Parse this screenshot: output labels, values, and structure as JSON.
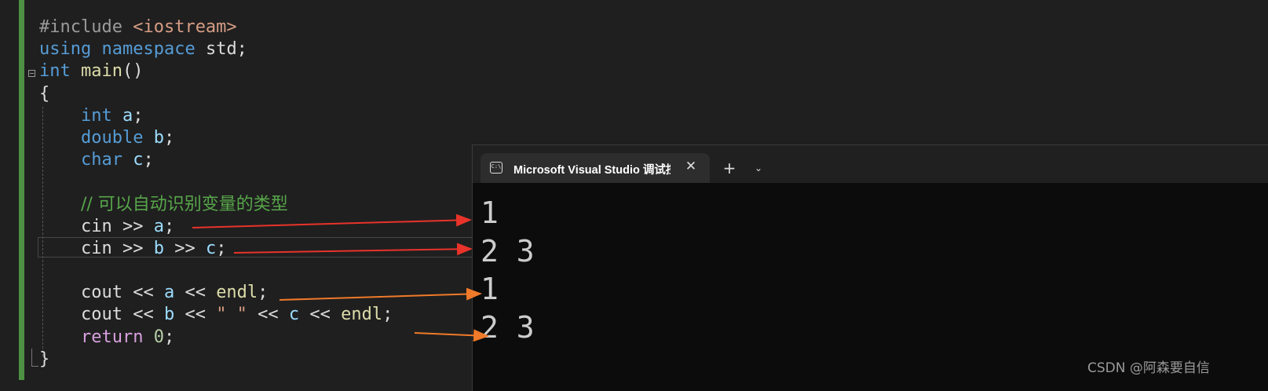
{
  "editor": {
    "lines": [
      [
        {
          "t": "#include ",
          "c": "pp"
        },
        {
          "t": "<iostream>",
          "c": "inc"
        }
      ],
      [
        {
          "t": "using",
          "c": "kw"
        },
        {
          "t": " "
        },
        {
          "t": "namespace",
          "c": "kw"
        },
        {
          "t": " std;"
        }
      ],
      [
        {
          "t": "int",
          "c": "kw"
        },
        {
          "t": " "
        },
        {
          "t": "main",
          "c": "fn"
        },
        {
          "t": "()"
        }
      ],
      [
        {
          "t": "{"
        }
      ],
      [
        {
          "t": "    "
        },
        {
          "t": "int",
          "c": "kw"
        },
        {
          "t": " "
        },
        {
          "t": "a",
          "c": "var"
        },
        {
          "t": ";"
        }
      ],
      [
        {
          "t": "    "
        },
        {
          "t": "double",
          "c": "kw"
        },
        {
          "t": " "
        },
        {
          "t": "b",
          "c": "var"
        },
        {
          "t": ";"
        }
      ],
      [
        {
          "t": "    "
        },
        {
          "t": "char",
          "c": "kw"
        },
        {
          "t": " "
        },
        {
          "t": "c",
          "c": "var"
        },
        {
          "t": ";"
        }
      ],
      [],
      [
        {
          "t": "    "
        },
        {
          "t": "// 可以自动识别变量的类型",
          "c": "cm"
        }
      ],
      [
        {
          "t": "    cin >> "
        },
        {
          "t": "a",
          "c": "var"
        },
        {
          "t": ";"
        }
      ],
      [
        {
          "t": "    cin >> "
        },
        {
          "t": "b",
          "c": "var"
        },
        {
          "t": " >> "
        },
        {
          "t": "c",
          "c": "var"
        },
        {
          "t": ";"
        }
      ],
      [],
      [
        {
          "t": "    cout << "
        },
        {
          "t": "a",
          "c": "var"
        },
        {
          "t": " << "
        },
        {
          "t": "endl",
          "c": "fn"
        },
        {
          "t": ";"
        }
      ],
      [
        {
          "t": "    cout << "
        },
        {
          "t": "b",
          "c": "var"
        },
        {
          "t": " << "
        },
        {
          "t": "\" \"",
          "c": "str"
        },
        {
          "t": " << "
        },
        {
          "t": "c",
          "c": "var"
        },
        {
          "t": " << "
        },
        {
          "t": "endl",
          "c": "fn"
        },
        {
          "t": ";"
        }
      ],
      [
        {
          "t": "    "
        },
        {
          "t": "return",
          "c": "ctl"
        },
        {
          "t": " "
        },
        {
          "t": "0",
          "c": "num"
        },
        {
          "t": ";"
        }
      ],
      [
        {
          "t": "}"
        }
      ]
    ]
  },
  "terminal": {
    "tab_title": "Microsoft Visual Studio 调试控",
    "tab_icon_text": "C:\\",
    "close_glyph": "✕",
    "new_tab_glyph": "+",
    "dropdown_glyph": "⌄",
    "output_lines": [
      "1",
      "2 3",
      "1",
      "2 3"
    ]
  },
  "colors": {
    "arrow_red": "#e8332a",
    "arrow_orange": "#f07a2a"
  },
  "watermark": "CSDN @阿森要自信"
}
